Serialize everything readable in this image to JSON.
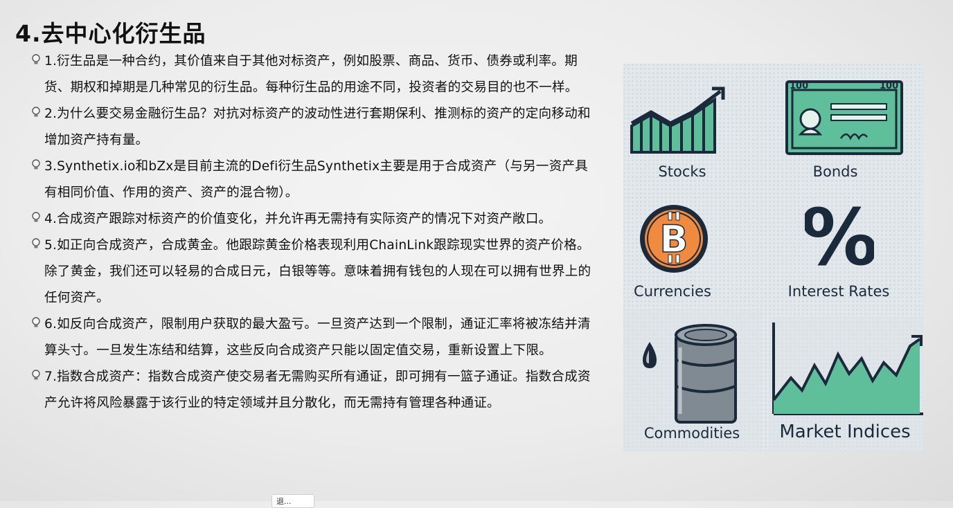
{
  "slide": {
    "title": "4.去中心化衍生品",
    "bullets": [
      "1.衍生品是一种合约，其价值来自于其他对标资产，例如股票、商品、货币、债券或利率。期货、期权和掉期是几种常见的衍生品。每种衍生品的用途不同，投资者的交易目的也不一样。",
      "2.为什么要交易金融衍生品？对抗对标资产的波动性进行套期保利、推测标的资产的定向移动和增加资产持有量。",
      "3.Synthetix.io和bZx是目前主流的Defi衍生品Synthetix主要是用于合成资产（与另一资产具有相同价值、作用的资产、资产的混合物）。",
      "4.合成资产跟踪对标资产的价值变化，并允许再无需持有实际资产的情况下对资产敞口。",
      "5.如正向合成资产，合成黄金。他跟踪黄金价格表现利用ChainLink跟踪现实世界的资产价格。除了黄金，我们还可以轻易的合成日元，白银等等。意味着拥有钱包的人现在可以拥有世界上的任何资产。",
      "6.如反向合成资产，限制用户获取的最大盈亏。一旦资产达到一个限制，通证汇率将被冻结并清算头寸。一旦发生冻结和结算，这些反向合成资产只能以固定值交易，重新设置上下限。",
      "7.指数合成资产：指数合成资产使交易者无需购买所有通证，即可拥有一篮子通证。指数合成资产允许将风险暴露于该行业的特定领域并且分散化，而无需持有管理各种通证。"
    ],
    "bullet_icon": "lightbulb-icon"
  },
  "infographic": {
    "stocks": {
      "label": "Stocks",
      "icon": "stock-chart-icon"
    },
    "bonds": {
      "label": "Bonds",
      "icon": "bond-certificate-icon",
      "denomination": "100"
    },
    "currencies": {
      "label": "Currencies",
      "icon": "bitcoin-icon",
      "symbol": "B"
    },
    "interest_rates": {
      "label": "Interest Rates",
      "icon": "percent-icon",
      "symbol": "%"
    },
    "commodities": {
      "label": "Commodities",
      "icon": "oil-barrel-icon"
    },
    "market_indices": {
      "label": "Market Indices",
      "icon": "index-chart-icon"
    }
  },
  "colors": {
    "navy": "#1b2a3a",
    "teal": "#5fbf9a",
    "orange": "#f08a3e",
    "panel": "#e3e8ec"
  },
  "tooltip": {
    "text": "退..."
  }
}
